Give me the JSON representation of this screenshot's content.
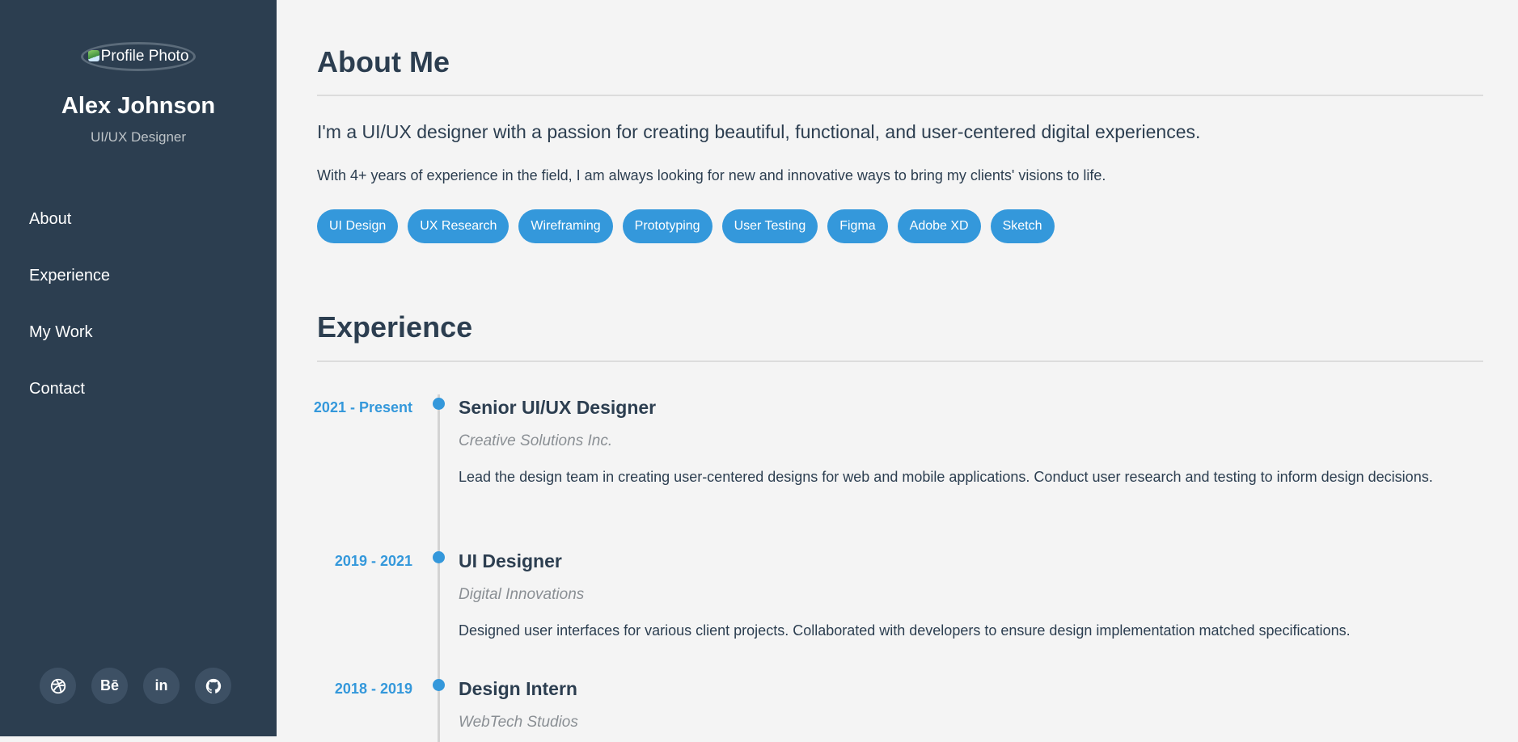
{
  "sidebar": {
    "photo_alt": "Profile Photo",
    "name": "Alex Johnson",
    "role": "UI/UX Designer",
    "nav": [
      {
        "label": "About"
      },
      {
        "label": "Experience"
      },
      {
        "label": "My Work"
      },
      {
        "label": "Contact"
      }
    ],
    "socials": [
      {
        "icon": "dribbble-icon",
        "glyph": "◎"
      },
      {
        "icon": "behance-icon",
        "glyph": "Bē"
      },
      {
        "icon": "linkedin-icon",
        "glyph": "in"
      },
      {
        "icon": "github-icon",
        "glyph": "◉"
      }
    ]
  },
  "about": {
    "title": "About Me",
    "lead": "I'm a UI/UX designer with a passion for creating beautiful, functional, and user-centered digital experiences.",
    "paragraph": "With 4+ years of experience in the field, I am always looking for new and innovative ways to bring my clients' visions to life.",
    "skills": [
      "UI Design",
      "UX Research",
      "Wireframing",
      "Prototyping",
      "User Testing",
      "Figma",
      "Adobe XD",
      "Sketch"
    ]
  },
  "experience": {
    "title": "Experience",
    "jobs": [
      {
        "date": "2021 - Present",
        "title": "Senior UI/UX Designer",
        "company": "Creative Solutions Inc.",
        "description": "Lead the design team in creating user-centered designs for web and mobile applications. Conduct user research and testing to inform design decisions."
      },
      {
        "date": "2019 - 2021",
        "title": "UI Designer",
        "company": "Digital Innovations",
        "description": "Designed user interfaces for various client projects. Collaborated with developers to ensure design implementation matched specifications."
      },
      {
        "date": "2018 - 2019",
        "title": "Design Intern",
        "company": "WebTech Studios",
        "description": ""
      }
    ]
  },
  "colors": {
    "sidebar_bg": "#2c3e50",
    "accent": "#3498db",
    "page_bg": "#f4f4f4"
  }
}
